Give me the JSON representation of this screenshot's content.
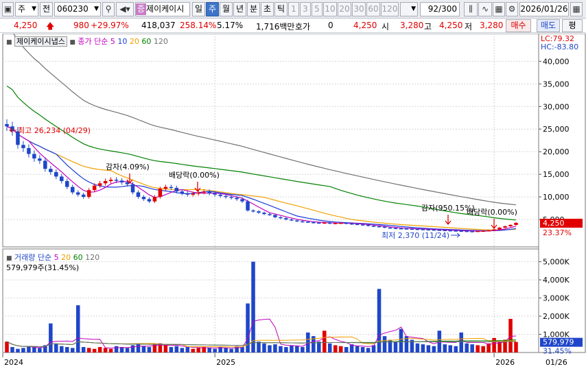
{
  "toolbar": {
    "type_select": "주",
    "prev_label": "전",
    "stock_code": "060230",
    "stock_tag": "증",
    "stock_name": "제이케이시",
    "period_buttons": [
      "일",
      "주",
      "월",
      "년",
      "분",
      "초",
      "틱"
    ],
    "selected_period": "주",
    "interval_buttons": [
      "1",
      "3",
      "5",
      "10",
      "20",
      "30",
      "60",
      "120"
    ],
    "page_count": "92",
    "page_total": "/300",
    "date": "2026/01/26"
  },
  "quote": {
    "price": "4,250",
    "change": "980",
    "change_pct": "+29.97%",
    "volume": "418,037",
    "volume_ratio": "258.14%",
    "turnover_rate": "5.17%",
    "amount": "1,716백만",
    "hoga_label": "호가",
    "hoga_value": "0",
    "hoga_price": "4,250",
    "open_label": "시",
    "open": "3,280",
    "high_label": "고",
    "high": "4,250",
    "low_label": "저",
    "low": "3,280",
    "buy_label": "매수",
    "sell_label": "매도",
    "eval_label": "평"
  },
  "price_panel": {
    "stock_title": "제이케이시냅스",
    "legend_prefix": "종가 단순",
    "ma_periods": [
      "5",
      "10",
      "20",
      "60",
      "120"
    ],
    "ma_colors": [
      "#c000c0",
      "#1a3cd8",
      "#f0a000",
      "#008000",
      "#707070"
    ],
    "lc_text": "LC:79.32",
    "hc_text": "HC:-83.80",
    "current_price_label": "4,250",
    "current_pct_label": "23.37%"
  },
  "volume_panel": {
    "legend_prefix": "거래량 단순",
    "ma_periods": [
      "5",
      "20",
      "60",
      "120"
    ],
    "volume_text": "579,979주(31.45%)",
    "current_volume_label": "579,979",
    "current_pct_label": "31.45%"
  },
  "annotations": {
    "high": "최고 26,234 (04/29)",
    "low": "최저 2,370 (11/24)",
    "events": [
      "감자(4.09%)",
      "배당락(0.00%)",
      "감자(950.15%)",
      "배당락(0.00%)"
    ]
  },
  "x_axis_labels": [
    "2024",
    "2025",
    "2026",
    "01/26"
  ],
  "chart_data": {
    "type": "candlestick",
    "price_ticks": [
      5000,
      10000,
      15000,
      20000,
      25000,
      30000,
      35000,
      40000
    ],
    "price_tick_labels": [
      "5,000",
      "10,000",
      "15,000",
      "20,000",
      "25,000",
      "30,000",
      "35,000",
      "40,000"
    ],
    "price_ylim": [
      0,
      44000
    ],
    "volume_ticks": [
      1000,
      2000,
      3000,
      4000,
      5000
    ],
    "volume_tick_labels": [
      "1,000K",
      "2,000K",
      "3,000K",
      "4,000K",
      "5,000K"
    ],
    "volume_ylim": [
      0,
      5400
    ],
    "close": [
      25600,
      24500,
      21500,
      20800,
      19500,
      18500,
      18000,
      16200,
      15500,
      14500,
      13500,
      12200,
      11000,
      10500,
      10000,
      11500,
      12500,
      13000,
      13500,
      13800,
      13600,
      13200,
      12800,
      11000,
      10000,
      9500,
      9000,
      10000,
      11800,
      12200,
      12000,
      11200,
      10800,
      10500,
      10700,
      11000,
      11200,
      10800,
      10500,
      10200,
      10000,
      9800,
      9500,
      9000,
      7000,
      6800,
      6500,
      6200,
      6000,
      5500,
      5300,
      5000,
      4800,
      4600,
      4500,
      4400,
      4300,
      4200,
      4300,
      4100,
      4200,
      4250,
      4100,
      4000,
      3900,
      3800,
      3600,
      3500,
      3400,
      3200,
      3100,
      3050,
      3000,
      2950,
      2900,
      2850,
      2800,
      2750,
      2700,
      2650,
      2600,
      2550,
      2500,
      2450,
      2400,
      2370,
      2450,
      2500,
      2600,
      2800,
      3200,
      3500,
      3800,
      4250
    ],
    "volume_k": [
      600,
      300,
      200,
      250,
      350,
      300,
      250,
      400,
      1600,
      500,
      350,
      300,
      250,
      2600,
      300,
      250,
      200,
      300,
      250,
      200,
      350,
      300,
      250,
      400,
      450,
      350,
      300,
      450,
      500,
      400,
      300,
      350,
      250,
      300,
      200,
      250,
      300,
      250,
      200,
      300,
      250,
      200,
      350,
      300,
      2700,
      5000,
      600,
      500,
      400,
      450,
      350,
      300,
      400,
      350,
      300,
      1100,
      900,
      600,
      1200,
      500,
      400,
      350,
      300,
      450,
      350,
      300,
      250,
      400,
      3500,
      900,
      700,
      600,
      1300,
      900,
      700,
      500,
      450,
      400,
      350,
      1200,
      450,
      400,
      350,
      1100,
      500,
      450,
      400,
      350,
      500,
      800,
      600,
      700,
      1850,
      580
    ]
  }
}
